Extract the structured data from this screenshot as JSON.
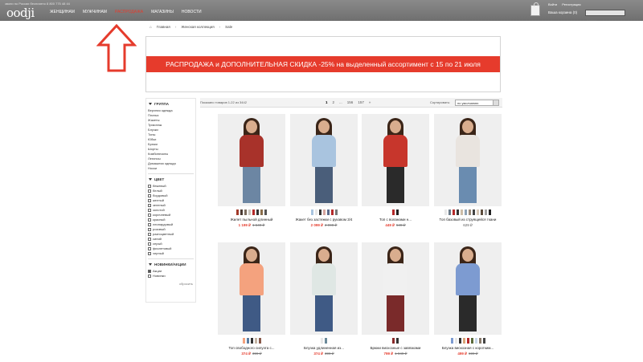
{
  "header": {
    "top_line": "звони по России бесплатно   8 800 775 48 44",
    "logo": "oodji",
    "nav": [
      "Женщинам",
      "Мужчинам",
      "Распродажа",
      "Магазины",
      "Новости"
    ],
    "active_nav": "Распродажа",
    "login": "Войти",
    "register": "Регистрация",
    "basket": "Ваша корзина (0)",
    "search_placeholder": "Поиск"
  },
  "breadcrumb": [
    "Главная",
    "Женская коллекция",
    "Sale"
  ],
  "banner": {
    "text": "РАСПРОДАЖА и ДОПОЛНИТЕЛЬНАЯ СКИДКА -25% на выделенный ассортимент с 15 по 21 июля",
    "color": "#e63b2c"
  },
  "annotation": {
    "arrow_color": "#e53b2c"
  },
  "sidebar": {
    "group_title": "Группа",
    "groups": [
      "Верхняя одежда",
      "Платья",
      "Жакеты",
      "Трикотаж",
      "Блузки",
      "Топы",
      "Юбки",
      "Брюки",
      "Шорты",
      "Комбинезоны",
      "Легинсы",
      "Домашняя одежда",
      "Носки"
    ],
    "color_title": "Цвет",
    "colors": [
      "бежевый",
      "белый",
      "бордовый",
      "желтый",
      "зеленый",
      "золотой",
      "коричневый",
      "красный",
      "леопардовый",
      "розовый",
      "разноцветный",
      "синий",
      "серый",
      "фиолетовый",
      "черный"
    ],
    "new_title": "Новинки/Акции",
    "new_options": [
      {
        "label": "Акции",
        "checked": true
      },
      {
        "label": "Новинки",
        "checked": false
      }
    ],
    "reset": "сбросить"
  },
  "listing": {
    "shown": "Показано товаров 1-22 из 3442",
    "pages": [
      "1",
      "2",
      "...",
      "156",
      "157",
      "»"
    ],
    "current_page": "1",
    "sort_label": "Сортировать:",
    "sort_value": "по умолчанию"
  },
  "products": [
    {
      "name": "Жилет пыльной длинный",
      "price": "1 199 ₽",
      "old_price": "1 649 ₽",
      "sale": true,
      "colors": [
        "#a23a2a",
        "#4b3b33",
        "#7a6b5d",
        "#c9c4bd",
        "#b52a2a",
        "#333333",
        "#8a6d4a",
        "#555555"
      ]
    },
    {
      "name": "Жакет без застежки с рукавом 3/4",
      "price": "2 099 ₽",
      "old_price": "2 999 ₽",
      "sale": true,
      "colors": [
        "#a9c4df",
        "#e8e8e8",
        "#333333",
        "#d7a6a0",
        "#5b6b8c",
        "#b52a2a",
        "#777777"
      ]
    },
    {
      "name": "Топ с воланами н...",
      "price": "449 ₽",
      "old_price": "549 ₽",
      "sale": true,
      "colors": [
        "#b52a2a",
        "#222222"
      ]
    },
    {
      "name": "Топ базовый из струящейся ткани",
      "price": "629 ₽",
      "old_price": "",
      "sale": false,
      "colors": [
        "#e8e8e8",
        "#6b7c8a",
        "#b52a2a",
        "#333333",
        "#cdbda8",
        "#8fa3b5",
        "#9a8a7a",
        "#444444",
        "#d7c7b7",
        "#5b4b3b",
        "#a0a0a0",
        "#222222"
      ]
    },
    {
      "name": "Топ свободного силуэта с...",
      "price": "374 ₽",
      "old_price": "399 ₽",
      "sale": true,
      "colors": [
        "#f4a27e",
        "#5b7ea3",
        "#333333",
        "#c4b5a5",
        "#8a5a4a"
      ]
    },
    {
      "name": "Блузка удлиненная из...",
      "price": "374 ₽",
      "old_price": "399 ₽",
      "sale": true,
      "colors": [
        "#e8e8e8",
        "#6b8a9a"
      ]
    },
    {
      "name": "Брюки вискозные с завязками",
      "price": "799 ₽",
      "old_price": "1 049 ₽",
      "sale": true,
      "colors": [
        "#8a2a2a",
        "#333333"
      ]
    },
    {
      "name": "Блузка вискозная с коротким...",
      "price": "499 ₽",
      "old_price": "699 ₽",
      "sale": true,
      "colors": [
        "#7d9bd1",
        "#e8e8e8",
        "#333333",
        "#d9a679",
        "#b52a2a",
        "#5b6b3b",
        "#c7d6e8",
        "#8a7a6a",
        "#444444"
      ]
    }
  ]
}
